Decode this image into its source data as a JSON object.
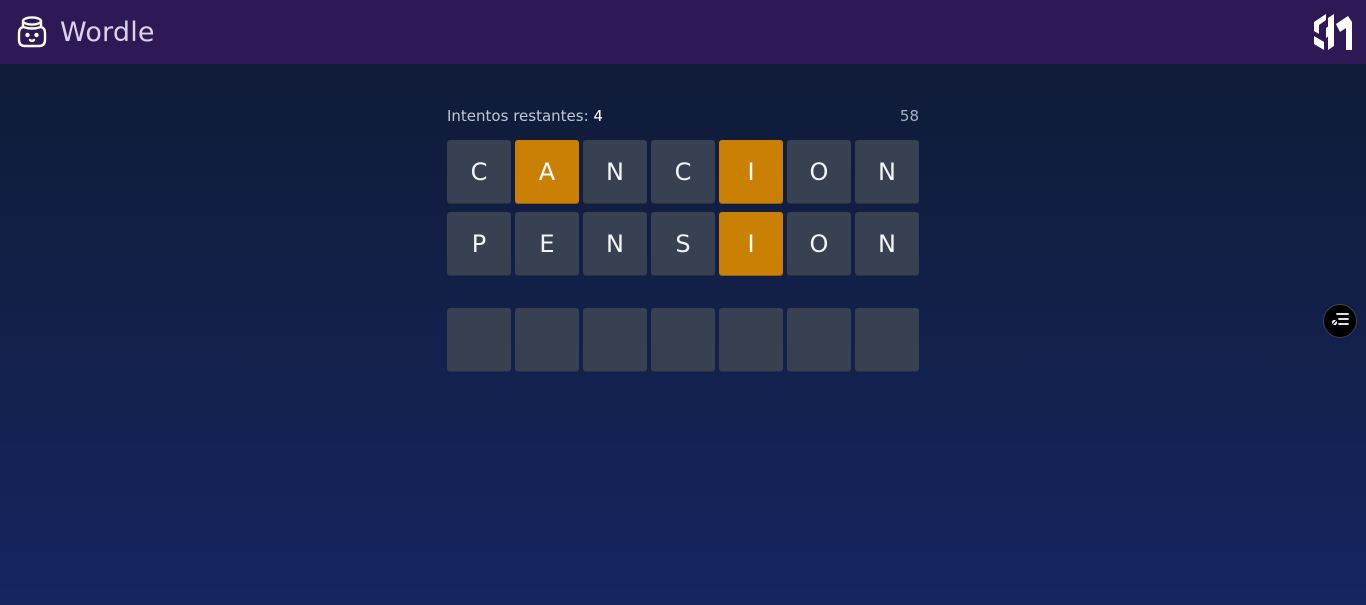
{
  "header": {
    "title": "Wordle",
    "logo_icon": "bucket-face-icon",
    "brand_icon": "midu-logo-icon",
    "background": "#2e1855"
  },
  "game": {
    "attempts_label": "Intentos restantes:",
    "attempts_remaining": "4",
    "timer": "58",
    "rows": [
      {
        "tiles": [
          {
            "letter": "C",
            "state": "absent"
          },
          {
            "letter": "A",
            "state": "present"
          },
          {
            "letter": "N",
            "state": "absent"
          },
          {
            "letter": "C",
            "state": "absent"
          },
          {
            "letter": "I",
            "state": "present"
          },
          {
            "letter": "O",
            "state": "absent"
          },
          {
            "letter": "N",
            "state": "absent"
          }
        ]
      },
      {
        "tiles": [
          {
            "letter": "P",
            "state": "absent"
          },
          {
            "letter": "E",
            "state": "absent"
          },
          {
            "letter": "N",
            "state": "absent"
          },
          {
            "letter": "S",
            "state": "absent"
          },
          {
            "letter": "I",
            "state": "present"
          },
          {
            "letter": "O",
            "state": "absent"
          },
          {
            "letter": "N",
            "state": "absent"
          }
        ]
      }
    ],
    "current_row": {
      "tiles": [
        "",
        "",
        "",
        "",
        "",
        "",
        ""
      ]
    },
    "colors": {
      "present": "#ca8004",
      "absent": "#374151"
    }
  },
  "side_button": {
    "icon": "filter-list-icon"
  }
}
